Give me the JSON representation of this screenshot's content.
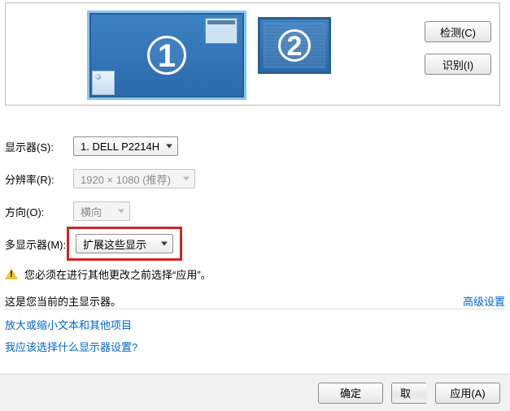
{
  "buttons": {
    "detect": "检测(C)",
    "identify": "识别(I)",
    "ok": "确定",
    "cancel": "取",
    "apply": "应用(A)"
  },
  "labels": {
    "display": "显示器(S):",
    "resolution": "分辨率(R):",
    "orientation": "方向(O):",
    "multi": "多显示器(M):"
  },
  "values": {
    "display": "1. DELL P2214H",
    "resolution": "1920 × 1080 (推荐)",
    "orientation": "横向",
    "multi": "扩展这些显示"
  },
  "monitors": {
    "primary": "1",
    "secondary": "2"
  },
  "warning": "您必须在进行其他更改之前选择“应用”。",
  "primary_note": "这是您当前的主显示器。",
  "advanced_link": "高级设置",
  "help_links": {
    "scale": "放大或缩小文本和其他项目",
    "which": "我应该选择什么显示器设置?"
  }
}
